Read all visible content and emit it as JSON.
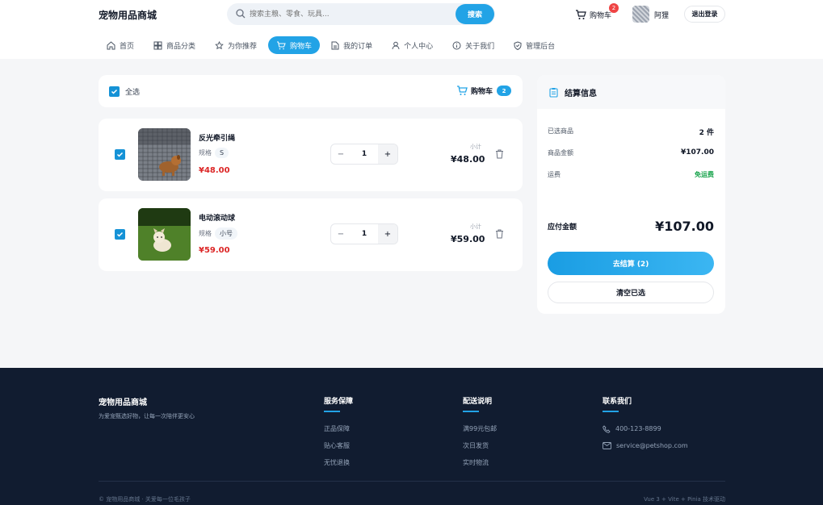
{
  "header": {
    "logo": "宠物用品商城",
    "search_placeholder": "搜索主粮、零食、玩具...",
    "search_button": "搜索",
    "cart_label": "购物车",
    "cart_badge": "2",
    "user_name": "阿狸",
    "logout": "退出登录"
  },
  "nav": [
    {
      "label": "首页",
      "icon": "home-icon"
    },
    {
      "label": "商品分类",
      "icon": "grid-icon"
    },
    {
      "label": "为你推荐",
      "icon": "star-icon"
    },
    {
      "label": "购物车",
      "icon": "cart-icon",
      "active": true
    },
    {
      "label": "我的订单",
      "icon": "document-icon"
    },
    {
      "label": "个人中心",
      "icon": "user-icon"
    },
    {
      "label": "关于我们",
      "icon": "info-icon"
    },
    {
      "label": "管理后台",
      "icon": "shield-icon"
    }
  ],
  "cart": {
    "select_all_label": "全选",
    "title": "购物车",
    "count": "2",
    "items": [
      {
        "name": "反光牵引绳",
        "spec_label": "规格",
        "spec": "S",
        "price": "¥48.00",
        "qty": "1",
        "subtotal_label": "小计",
        "subtotal": "¥48.00"
      },
      {
        "name": "电动滚动球",
        "spec_label": "规格",
        "spec": "小号",
        "price": "¥59.00",
        "qty": "1",
        "subtotal_label": "小计",
        "subtotal": "¥59.00"
      }
    ]
  },
  "summary": {
    "title": "结算信息",
    "selected_label": "已选商品",
    "selected_value": "2 件",
    "amount_label": "商品金额",
    "amount_value": "¥107.00",
    "shipping_label": "运费",
    "shipping_value": "免运费",
    "total_label": "应付金额",
    "total_value": "¥107.00",
    "checkout_button": "去结算 (2)",
    "clear_button": "清空已选"
  },
  "footer": {
    "brand": "宠物用品商城",
    "tagline": "为爱宠甄选好物，让每一次陪伴更安心",
    "col1_title": "服务保障",
    "col1_items": [
      "正品保障",
      "贴心客服",
      "无忧退换"
    ],
    "col2_title": "配送说明",
    "col2_items": [
      "满99元包邮",
      "次日发货",
      "实时物流"
    ],
    "col3_title": "联系我们",
    "phone": "400-123-8899",
    "email": "service@petshop.com",
    "copyright": "© 宠物用品商城 · 关爱每一位毛孩子",
    "tech": "Vue 3 + Vite + Pinia 技术驱动"
  },
  "colors": {
    "accent": "#22a3e6",
    "price": "#dc2626",
    "free": "#16a34a",
    "footer_bg": "#111c30"
  }
}
